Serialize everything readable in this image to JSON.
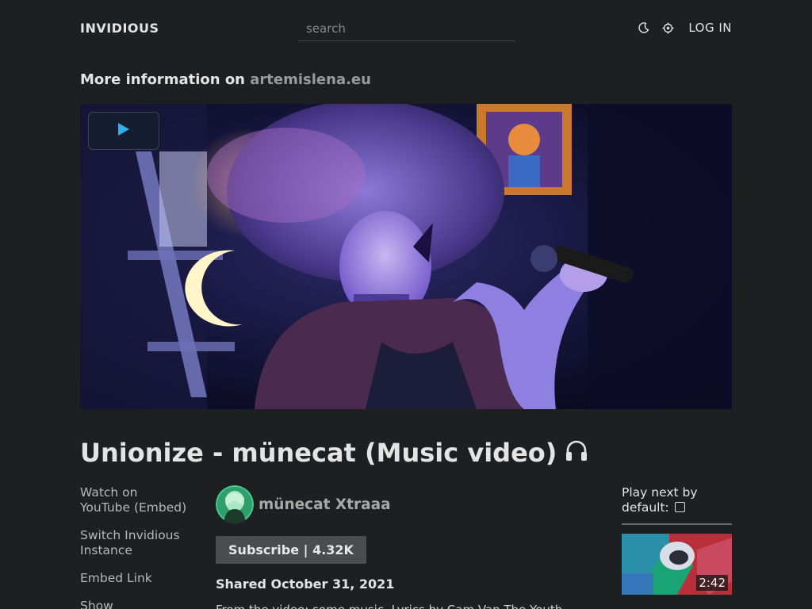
{
  "header": {
    "brand": "INVIDIOUS",
    "search_placeholder": "search",
    "theme_icon": "moon-icon",
    "prefs_icon": "gear-icon",
    "login": "LOG IN"
  },
  "more_info": {
    "prefix": "More information on",
    "link": "artemislena.eu"
  },
  "player": {
    "play_icon": "play-icon",
    "accent": "#2fb1ee"
  },
  "video": {
    "title": "Unionize - münecat (Music video)",
    "title_icon": "headphones-icon"
  },
  "sidebar_left": {
    "watch_on": "Watch on",
    "youtube": "YouTube",
    "embed_paren_open": " (",
    "embed": "Embed",
    "embed_paren_close": ")",
    "switch_instance": "Switch Invidious Instance",
    "embed_link": "Embed Link",
    "show": "Show"
  },
  "channel": {
    "name": "münecat Xtraaa",
    "subscribe": "Subscribe | 4.32K",
    "shared": "Shared October 31, 2021",
    "description": "From the video: some music. Lyrics by Cam Van The Youth"
  },
  "sidebar_right": {
    "play_next": "Play next by default:",
    "next_duration": "2:42"
  }
}
